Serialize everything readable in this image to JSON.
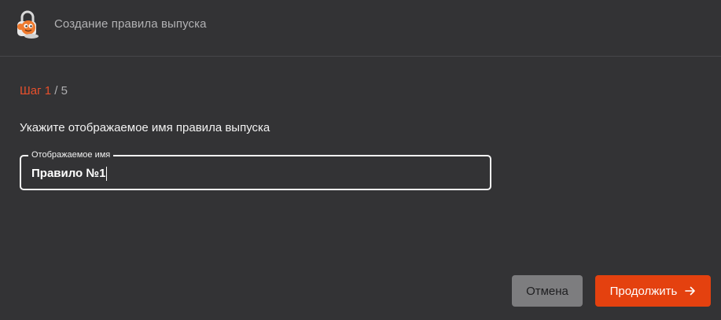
{
  "header": {
    "logo_icon": "lock-mascot-logo-icon",
    "title": "Создание правила выпуска"
  },
  "step": {
    "current": "Шаг 1",
    "total": " / 5"
  },
  "prompt": "Укажите отображаемое имя правила выпуска",
  "display_name_field": {
    "label": "Отображаемое имя",
    "value": "Правило №1"
  },
  "buttons": {
    "cancel_label": "Отмена",
    "continue_label": "Продолжить",
    "continue_icon": "arrow-right-icon"
  },
  "colors": {
    "background": "#333335",
    "accent": "#e4410f",
    "step_accent": "#e8502c",
    "cancel_button": "#7d7d7f"
  }
}
